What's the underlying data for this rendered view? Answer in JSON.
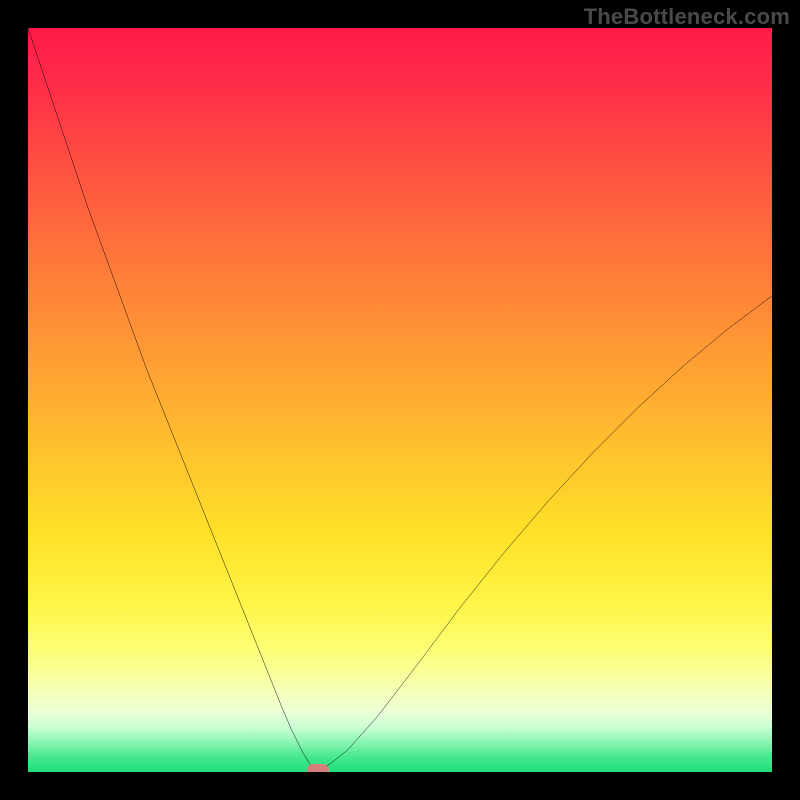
{
  "watermark": "TheBottleneck.com",
  "colors": {
    "frame_bg": "#000000",
    "watermark_text": "#4a4a4a",
    "curve_stroke": "#000000",
    "marker_fill": "#d87d7d",
    "gradient_top": "#ff1a49",
    "gradient_bottom": "#1fde7b"
  },
  "chart_data": {
    "type": "line",
    "title": "",
    "xlabel": "",
    "ylabel": "",
    "xlim": [
      0,
      100
    ],
    "ylim": [
      0,
      100
    ],
    "grid": false,
    "legend": false,
    "series": [
      {
        "name": "bottleneck-curve",
        "x": [
          0,
          2,
          5,
          8,
          12,
          16,
          20,
          24,
          28,
          32,
          34,
          35.5,
          37,
          37.8,
          38.3,
          39,
          40.5,
          43,
          47,
          52,
          58,
          64,
          70,
          76,
          82,
          88,
          94,
          100
        ],
        "y": [
          100,
          94,
          85,
          76,
          65,
          54,
          44,
          34,
          24,
          14,
          9,
          5.5,
          2.5,
          1.2,
          0.5,
          0.5,
          1,
          3,
          7.5,
          14,
          22,
          29.5,
          36.5,
          43,
          49,
          54.5,
          59.5,
          64
        ]
      }
    ],
    "annotations": [
      {
        "name": "optimal-marker",
        "x": 39,
        "y": 0.3,
        "shape": "pill",
        "color": "#d87d7d"
      }
    ],
    "background": {
      "type": "vertical-gradient",
      "stops": [
        {
          "pos": 0.0,
          "color": "#ff1a49"
        },
        {
          "pos": 0.32,
          "color": "#ff7a3a"
        },
        {
          "pos": 0.68,
          "color": "#ffe128"
        },
        {
          "pos": 0.89,
          "color": "#f6ffb5"
        },
        {
          "pos": 1.0,
          "color": "#1fde7b"
        }
      ]
    }
  }
}
